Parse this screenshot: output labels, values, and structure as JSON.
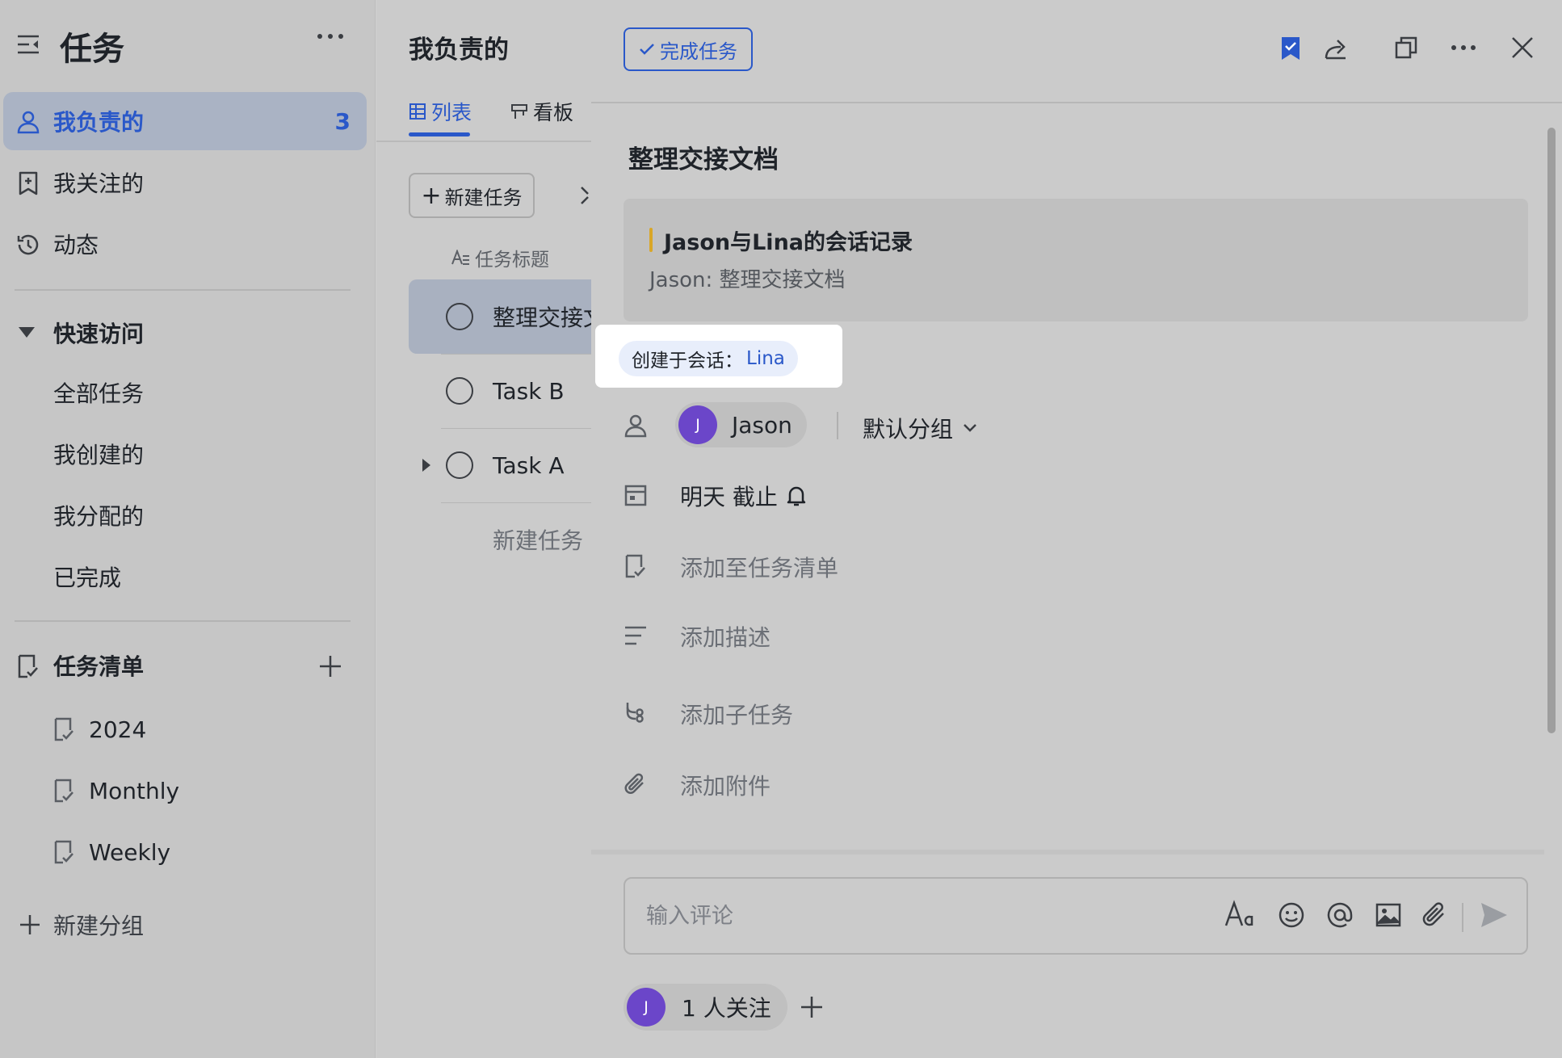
{
  "sidebar": {
    "title": "任务",
    "nav": [
      {
        "label": "我负责的",
        "count": "3",
        "icon": "person-icon"
      },
      {
        "label": "我关注的",
        "icon": "bookmark-add-icon"
      },
      {
        "label": "动态",
        "icon": "history-icon"
      }
    ],
    "quick_access": {
      "label": "快速访问",
      "items": [
        "全部任务",
        "我创建的",
        "我分配的",
        "已完成"
      ]
    },
    "task_lists": {
      "label": "任务清单",
      "items": [
        "2024",
        "Monthly",
        "Weekly"
      ]
    },
    "new_group_label": "新建分组"
  },
  "middle": {
    "title": "我负责的",
    "tabs": [
      "列表",
      "看板"
    ],
    "new_task_label": "新建任务",
    "column_header": "任务标题",
    "tasks": [
      "整理交接文档",
      "Task B",
      "Task A"
    ],
    "new_task_inline": "新建任务"
  },
  "detail": {
    "complete_label": "完成任务",
    "title": "整理交接文档",
    "quote": {
      "title": "Jason与Lina的会话记录",
      "body": "Jason: 整理交接文档"
    },
    "source": {
      "prefix": "创建于会话：",
      "chat": "Lina"
    },
    "assignee": {
      "name": "Jason",
      "initial": "J"
    },
    "group": "默认分组",
    "due": "明天 截止",
    "add_to_list": "添加至任务清单",
    "add_description": "添加描述",
    "add_subtask": "添加子任务",
    "add_attachment": "添加附件",
    "comment_placeholder": "输入评论",
    "followers": {
      "count_label": "1 人关注",
      "initial": "J"
    }
  },
  "colors": {
    "accent": "#2a58c9",
    "avatar": "#6b46c9",
    "quote_bar": "#d9a627",
    "highlight": "#ffffff"
  }
}
